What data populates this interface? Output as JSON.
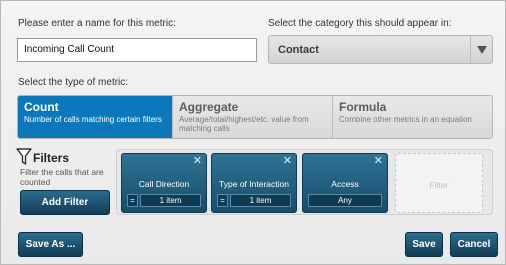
{
  "name_section": {
    "label": "Please enter a name for this metric:",
    "value": "Incoming Call Count"
  },
  "category_section": {
    "label": "Select the category this should appear in:",
    "selected": "Contact"
  },
  "metric_type": {
    "label": "Select the type of metric:",
    "tabs": [
      {
        "title": "Count",
        "desc": "Number of calls matching certain filters"
      },
      {
        "title": "Aggregate",
        "desc": "Average/total/highest/etc. value from matching calls"
      },
      {
        "title": "Formula",
        "desc": "Combine other metrics in an equation"
      }
    ],
    "active": "Count"
  },
  "filters": {
    "title": "Filters",
    "desc": "Filter the calls that are counted",
    "add_button": "Add Filter",
    "cards": [
      {
        "title": "Call Direction",
        "operator": "=",
        "value": "1 item"
      },
      {
        "title": "Type of Interaction",
        "operator": "=",
        "value": "1 item"
      },
      {
        "title": "Access",
        "operator": "",
        "value": "Any"
      }
    ],
    "placeholder": "Filter"
  },
  "footer": {
    "save_as": "Save As ...",
    "save": "Save",
    "cancel": "Cancel"
  },
  "colors": {
    "active_tab": "#0c78bb",
    "dark_button": "#174d6b"
  },
  "icons": {
    "close": "close-icon",
    "dropdown": "chevron-down-icon",
    "filters": "funnel-icon"
  }
}
